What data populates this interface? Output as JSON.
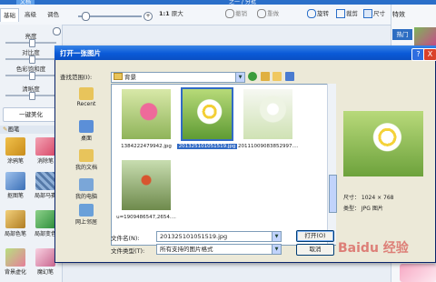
{
  "app": {
    "top_tabs": [
      "文档",
      "",
      "",
      "",
      "",
      "",
      "之一 / 分批"
    ],
    "left_tabs": [
      "基础",
      "高级",
      "调色"
    ],
    "toolbar": {
      "ratio_label": "1:1",
      "fit_label": "原大",
      "undo_label": "撤销",
      "redo_label": "重做",
      "rotate_label": "旋转",
      "crop_label": "裁剪",
      "size_label": "尺寸"
    },
    "adjust_sliders": [
      "亮度",
      "对比度",
      "色彩饱和度",
      "清晰度"
    ],
    "oneclick_label": "一键美化",
    "brush_section": "画笔",
    "tools": [
      "涂鸦笔",
      "消除笔",
      "抠图笔",
      "局部马赛",
      "局部色笔",
      "局部变色",
      "背景虚化",
      "魔幻笔"
    ],
    "effects_title": "特效",
    "hot_label": "热门"
  },
  "dialog": {
    "title": "打开一张图片",
    "help": "?",
    "close": "X",
    "look_in_label": "查找范围(I):",
    "look_in_value": "背景",
    "places": [
      "Recent",
      "桌面",
      "我的文档",
      "我的电脑",
      "网上邻居"
    ],
    "files": [
      {
        "name": "1384222479942.jpg",
        "selected": false
      },
      {
        "name": "20132510105151​9.jpg",
        "selected": true
      },
      {
        "name": "20111009083852997....",
        "selected": false
      },
      {
        "name": "u=1909486547,2654....",
        "selected": false
      }
    ],
    "preview": {
      "size": "尺寸： 1024 × 768",
      "type": "类型： JPG 图片"
    },
    "filename_label": "文件名(N):",
    "filename_value": "201325101051519.jpg",
    "filetype_label": "文件类型(T):",
    "filetype_value": "所有支持的图片格式",
    "open_button": "打开(O)",
    "cancel_button": "取消"
  },
  "watermark": "Baidu 经验"
}
